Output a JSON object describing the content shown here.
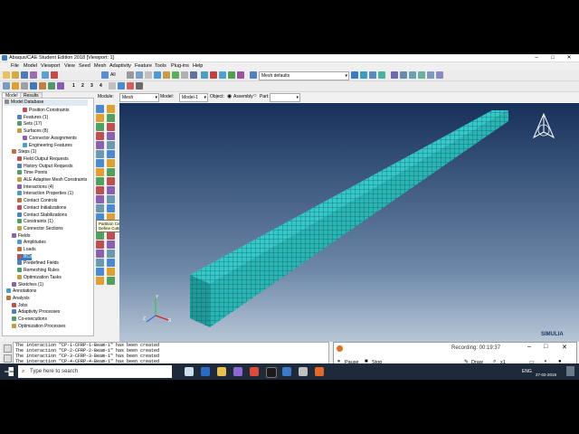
{
  "window": {
    "title": "Abaqus/CAE Student Edition 2018 [Viewport: 1]"
  },
  "menu": [
    "File",
    "Model",
    "Viewport",
    "View",
    "Seed",
    "Mesh",
    "Adaptivity",
    "Feature",
    "Tools",
    "Plug-ins",
    "Help"
  ],
  "toolbar": {
    "numbers": [
      "1",
      "2",
      "3",
      "4"
    ],
    "all_label": "All",
    "mesh_defaults": "Mesh defaults",
    "module_label": "Module:",
    "module_value": "Mesh",
    "model_label": "Model:",
    "model_value": "Model-1",
    "object_label": "Object:",
    "assembly_label": "Assembly",
    "part_label": "Part:"
  },
  "tabs": [
    "Model",
    "Results"
  ],
  "tree": {
    "db_label": "Model Database",
    "rows": [
      {
        "label": "Position Constraints",
        "indent": 3
      },
      {
        "label": "Features (1)",
        "indent": 2
      },
      {
        "label": "Sets (17)",
        "indent": 2
      },
      {
        "label": "Surfaces (8)",
        "indent": 2
      },
      {
        "label": "Connector Assignments",
        "indent": 3
      },
      {
        "label": "Engineering Features",
        "indent": 3
      },
      {
        "label": "Steps (1)",
        "indent": 1
      },
      {
        "label": "Field Output Requests",
        "indent": 2
      },
      {
        "label": "History Output Requests",
        "indent": 2
      },
      {
        "label": "Time Points",
        "indent": 2
      },
      {
        "label": "ALE Adaptive Mesh Constraints",
        "indent": 2
      },
      {
        "label": "Interactions (4)",
        "indent": 2
      },
      {
        "label": "Interaction Properties (1)",
        "indent": 2
      },
      {
        "label": "Contact Controls",
        "indent": 2
      },
      {
        "label": "Contact Initializations",
        "indent": 2
      },
      {
        "label": "Contact Stabilizations",
        "indent": 2
      },
      {
        "label": "Constraints (1)",
        "indent": 2
      },
      {
        "label": "Connector Sections",
        "indent": 2
      },
      {
        "label": "Fields",
        "indent": 1
      },
      {
        "label": "Amplitudes",
        "indent": 2
      },
      {
        "label": "Loads",
        "indent": 2
      },
      {
        "label": "BCs",
        "indent": 2,
        "highlight": true
      },
      {
        "label": "Predefined Fields",
        "indent": 2
      },
      {
        "label": "Remeshing Rules",
        "indent": 2
      },
      {
        "label": "Optimization Tasks",
        "indent": 2
      },
      {
        "label": "Sketches (1)",
        "indent": 1
      },
      {
        "label": "Annotations",
        "indent": 0
      },
      {
        "label": "Analysis",
        "indent": 0
      },
      {
        "label": "Jobs",
        "indent": 1
      },
      {
        "label": "Adaptivity Processes",
        "indent": 1
      },
      {
        "label": "Co-executions",
        "indent": 1
      },
      {
        "label": "Optimization Processes",
        "indent": 1
      }
    ]
  },
  "tooltip": {
    "line1": "Partition Cell:",
    "line2": "Define Cutting Plane"
  },
  "messages": [
    "The interaction \"CP-1-CFRP-1-Beam-1\" has been created",
    "The interaction \"CP-2-CFRP-2-Beam-1\" has been created",
    "The interaction \"CP-3-CFRP-3-Beam-1\" has been created",
    "The interaction \"CP-4-CFRP-4-Beam-1\" has been created"
  ],
  "triad": {
    "x": "X",
    "y": "Y",
    "z": "Z"
  },
  "brand": "SIMULIA",
  "recorder": {
    "recording_label": "Recording: 00:19:37",
    "pause": "Pause",
    "stop": "Stop",
    "draw": "Draw",
    "zoom": "x1"
  },
  "taskbar": {
    "search_placeholder": "Type here to search",
    "lang": "ENG",
    "date": "27-02-2019"
  },
  "colors": {
    "mesh": "#2ab5b5",
    "mesh_top": "#35c8c8",
    "mesh_side": "#1f9a9a",
    "grid": "#0c3d40",
    "viewport_top": "#16305a"
  }
}
